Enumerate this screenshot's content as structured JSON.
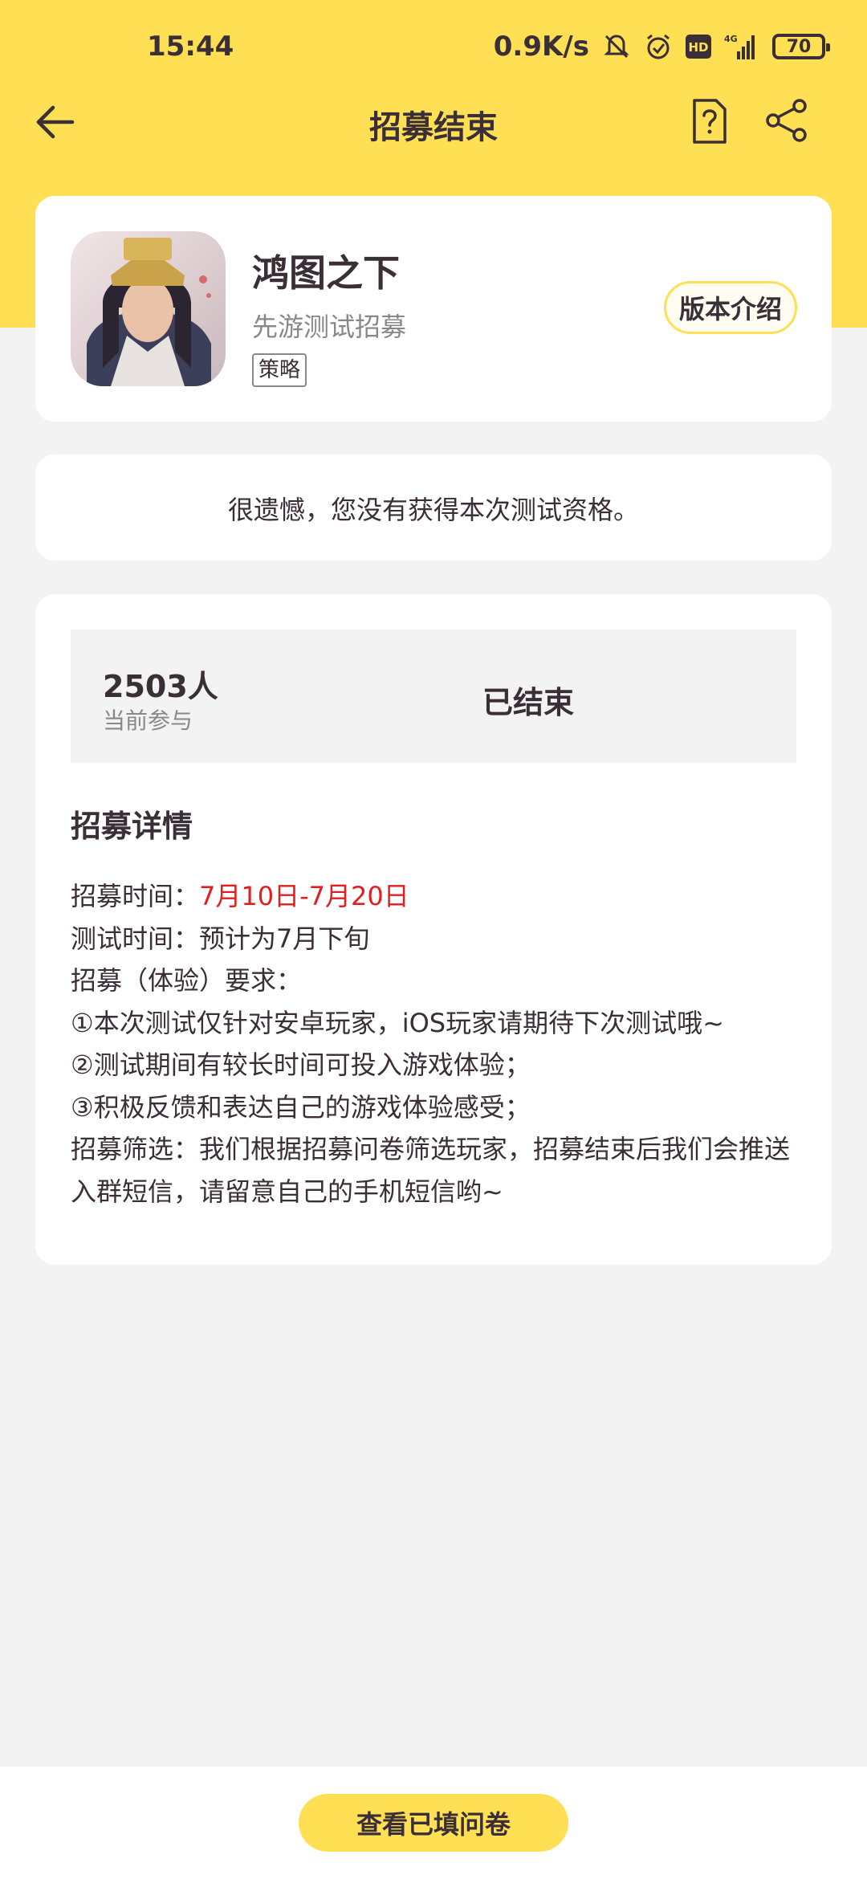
{
  "status_bar": {
    "time": "15:44",
    "network_speed": "0.9K/s",
    "signal_type": "4G",
    "hd_label": "HD",
    "battery": "70",
    "icons": [
      "mute-icon",
      "alarm-icon",
      "hd-icon",
      "signal-icon",
      "battery-icon"
    ]
  },
  "header": {
    "title": "招募结束",
    "back_icon": "arrow-left-icon",
    "help_icon": "question-doc-icon",
    "share_icon": "share-icon"
  },
  "game": {
    "name": "鸿图之下",
    "subtitle": "先游测试招募",
    "tag": "策略",
    "version_button": "版本介绍"
  },
  "notice": {
    "text": "很遗憾，您没有获得本次测试资格。"
  },
  "stats": {
    "count": "2503人",
    "count_label": "当前参与",
    "status": "已结束"
  },
  "details": {
    "heading": "招募详情",
    "recruit_time_label": "招募时间：",
    "recruit_time_value": "7月10日-7月20日",
    "test_time": "测试时间：预计为7月下旬",
    "requirement_title": "招募（体验）要求：",
    "req1": "①本次测试仅针对安卓玩家，iOS玩家请期待下次测试哦~",
    "req2": "②测试期间有较长时间可投入游戏体验；",
    "req3": "③积极反馈和表达自己的游戏体验感受；",
    "screening": "招募筛选：我们根据招募问卷筛选玩家，招募结束后我们会推送入群短信，请留意自己的手机短信哟~"
  },
  "colors": {
    "accent_yellow": "#FFE055",
    "highlight_red": "#E02020",
    "text_dark": "#3A2E37",
    "background": "#F3F3F3"
  },
  "bottom": {
    "button_label": "查看已填问卷"
  }
}
